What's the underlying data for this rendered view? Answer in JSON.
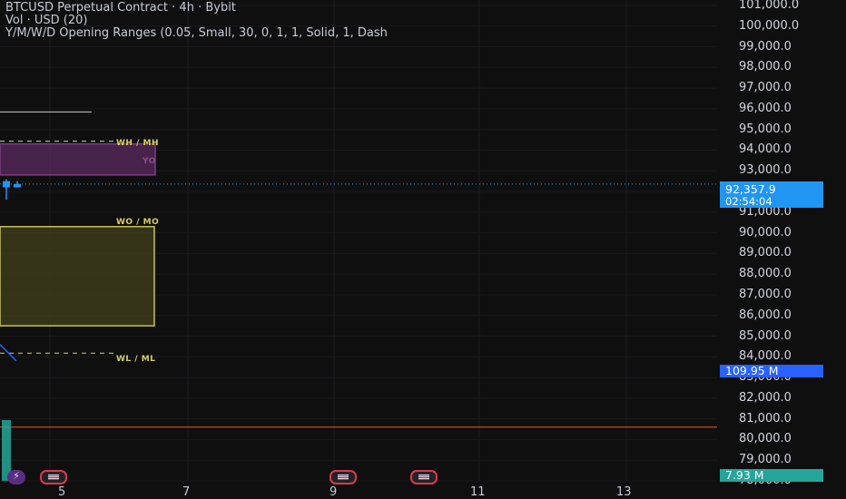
{
  "legend": {
    "line1": "BTCUSD Perpetual Contract · 4h · Bybit",
    "line2": "Vol · USD (20)",
    "line3": "Y/M/W/D Opening Ranges (0.05, Small, 30, 0, 1, 1, Solid, 1, Dash"
  },
  "price_badge": {
    "price": "92,357.9",
    "countdown": "02:54:04"
  },
  "vol_badge": "109.95 M",
  "vol_badge2": "7.93 M",
  "zones": {
    "wh_mh": "WH / MH",
    "yo": "YO",
    "wo_mo": "WO / MO",
    "wl_ml": "WL / ML"
  },
  "colors": {
    "bg": "#0f0f10",
    "accent_blue": "#2196f3",
    "zone_purple": "#5b2a5e",
    "zone_olive": "#3f3d1c",
    "zone_yellow": "#d8d05a",
    "vol_green": "#26a69a",
    "red_line": "#e0642e"
  },
  "chart_data": {
    "type": "candlestick",
    "ylim": [
      78000,
      101000
    ],
    "y_ticks": [
      101000,
      100000,
      99000,
      98000,
      97000,
      96000,
      95000,
      94000,
      93000,
      92000,
      91000,
      90000,
      89000,
      88000,
      87000,
      86000,
      85000,
      84000,
      83000,
      82000,
      81000,
      80000,
      79000,
      78000
    ],
    "y_tick_labels": [
      "101,000.0",
      "100,000.0",
      "99,000.0",
      "98,000.0",
      "97,000.0",
      "96,000.0",
      "95,000.0",
      "94,000.0",
      "93,000.0",
      "92,000.0",
      "91,000.0",
      "90,000.0",
      "89,000.0",
      "88,000.0",
      "87,000.0",
      "86,000.0",
      "85,000.0",
      "84,000.0",
      "83,000.0",
      "82,000.0",
      "81,000.0",
      "80,000.0",
      "79,000.0",
      "78,000.0"
    ],
    "x_labels": [
      "5",
      "7",
      "9",
      "11",
      "13"
    ],
    "current_price": 92357.9,
    "levels": {
      "wh_mh": 94300,
      "wo_mo": 90300,
      "wo_mo_bottom": 85500,
      "wl_ml": 84000,
      "yo_top": 94300,
      "yo_bottom": 92800,
      "upper_line": 95850,
      "red_line": 80600
    },
    "candles": [
      {
        "time": "4",
        "open": 92500,
        "high": 92600,
        "low": 91600,
        "close": 92200
      },
      {
        "time": "4",
        "open": 92200,
        "high": 92500,
        "low": 92200,
        "close": 92357.9
      }
    ],
    "volume": {
      "last": "109.95 M",
      "bar": "7.93 M"
    }
  }
}
